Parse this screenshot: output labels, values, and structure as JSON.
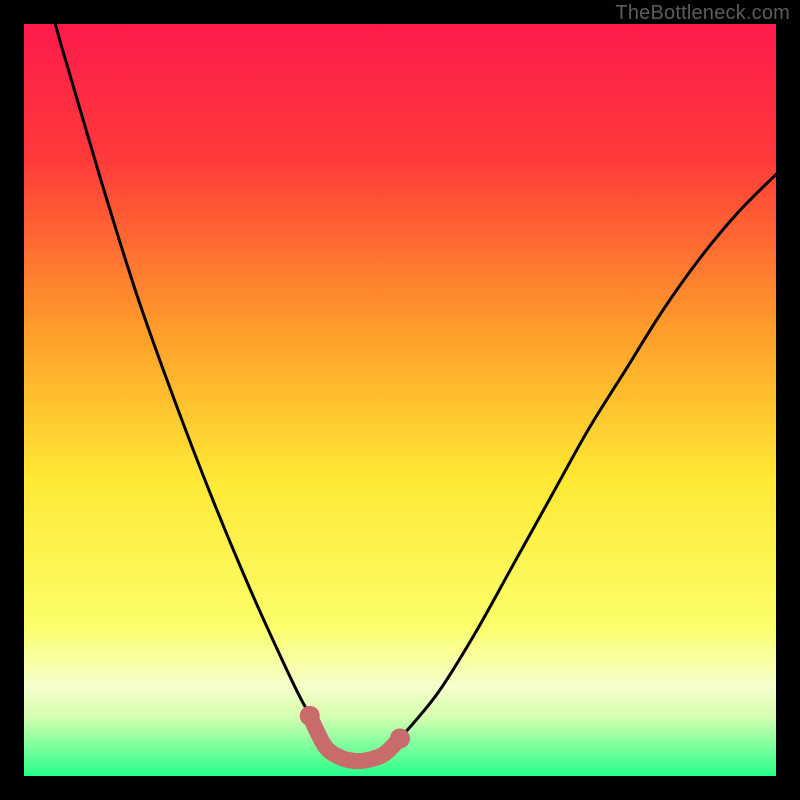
{
  "watermark": "TheBottleneck.com",
  "colors": {
    "frame": "#000000",
    "gradient_top": "#ff1b4c",
    "gradient_mid1": "#ff7d32",
    "gradient_mid2": "#ffe733",
    "gradient_pale": "#f6ffcb",
    "gradient_bottom": "#26ff8a",
    "curve": "#000000",
    "marker_stroke": "#c96b6b",
    "marker_fill": "#c96b6b"
  },
  "chart_data": {
    "type": "line",
    "title": "",
    "xlabel": "",
    "ylabel": "",
    "xlim": [
      0,
      100
    ],
    "ylim": [
      0,
      100
    ],
    "grid": false,
    "legend": false,
    "series": [
      {
        "name": "bottleneck-curve",
        "x": [
          0,
          5,
          10,
          15,
          20,
          25,
          30,
          35,
          37.5,
          40,
          42,
          44,
          46,
          48,
          50,
          55,
          60,
          65,
          70,
          75,
          80,
          85,
          90,
          95,
          100
        ],
        "y": [
          115,
          97,
          80,
          64,
          50,
          37,
          25,
          14,
          9,
          5,
          3,
          2,
          2,
          3,
          5,
          11,
          19,
          28,
          37,
          46,
          54,
          62,
          69,
          75,
          80
        ]
      }
    ],
    "valley_markers": {
      "name": "optimal-range",
      "x": [
        38,
        40,
        42,
        44,
        46,
        48,
        50
      ],
      "y": [
        8,
        4,
        2.5,
        2,
        2.2,
        3,
        5
      ]
    },
    "gradient_stops": [
      {
        "offset": 0.0,
        "color": "#ff1b4c"
      },
      {
        "offset": 0.18,
        "color": "#ff3a3a"
      },
      {
        "offset": 0.4,
        "color": "#ff9a2a"
      },
      {
        "offset": 0.6,
        "color": "#ffe733"
      },
      {
        "offset": 0.8,
        "color": "#fbff6a"
      },
      {
        "offset": 0.88,
        "color": "#f6ffcb"
      },
      {
        "offset": 0.92,
        "color": "#d6ffb0"
      },
      {
        "offset": 1.0,
        "color": "#26ff8a"
      }
    ]
  }
}
